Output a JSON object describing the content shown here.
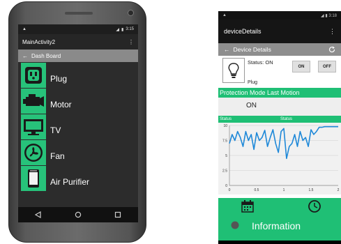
{
  "left_phone": {
    "status_bar": {
      "time": "3:15"
    },
    "app_bar": {
      "title": "MainActivity2"
    },
    "sub_bar": {
      "back_glyph": "←",
      "title": "Dash Board"
    },
    "items": [
      {
        "label": "Plug",
        "icon": "plug-icon"
      },
      {
        "label": "Motor",
        "icon": "motor-icon"
      },
      {
        "label": "TV",
        "icon": "tv-icon"
      },
      {
        "label": "Fan",
        "icon": "fan-icon"
      },
      {
        "label": "Air Purifier",
        "icon": "air-purifier-icon"
      }
    ]
  },
  "right_phone": {
    "status_bar": {
      "time": "3:18"
    },
    "app_bar": {
      "title": "deviceDetails"
    },
    "sub_bar": {
      "back_glyph": "←",
      "title": "Device Details"
    },
    "device": {
      "status_text": "Status: ON",
      "on_label": "ON",
      "off_label": "OFF",
      "name": "Plug"
    },
    "protection_bar": {
      "label": "Protection Mode  Last Motion"
    },
    "protection_value": "ON",
    "status_labels": [
      "Status",
      "Status"
    ],
    "info_label": "Information"
  },
  "colors": {
    "accent_green": "#1fbf75",
    "icon_green": "#27c27a",
    "line_blue": "#1e88d8"
  },
  "chart_data": {
    "type": "line",
    "y_ticks": [
      "10",
      "7.5",
      "5",
      "2.5",
      "0"
    ],
    "x_ticks": [
      "0",
      "0.5",
      "1",
      "1.5",
      "2"
    ],
    "ylim": [
      0,
      10
    ],
    "xlim": [
      0,
      2
    ],
    "series": [
      {
        "x": [
          0,
          0.05,
          0.1,
          0.15,
          0.2,
          0.25,
          0.3,
          0.35,
          0.4,
          0.45,
          0.5,
          0.55,
          0.6,
          0.65,
          0.7,
          0.75,
          0.8,
          0.85,
          0.9,
          0.95,
          1.0,
          1.05,
          1.1,
          1.15,
          1.2,
          1.25,
          1.3,
          1.35,
          1.4,
          1.45,
          1.5,
          1.55,
          1.6,
          1.65,
          1.7,
          1.75,
          1.8,
          1.85,
          1.9,
          1.95,
          2.0
        ],
        "y": [
          7.0,
          8.5,
          7.5,
          9.0,
          8.0,
          6.5,
          9.0,
          7.5,
          8.5,
          6.0,
          8.8,
          7.5,
          8.0,
          9.2,
          6.5,
          8.0,
          9.3,
          7.0,
          5.5,
          9.0,
          9.5,
          4.5,
          6.5,
          7.0,
          8.5,
          6.5,
          9.0,
          7.5,
          8.0,
          6.5,
          9.3,
          8.5,
          9.0,
          9.7,
          9.7,
          9.8,
          9.8,
          9.8,
          9.8,
          9.8,
          9.8
        ]
      }
    ]
  }
}
